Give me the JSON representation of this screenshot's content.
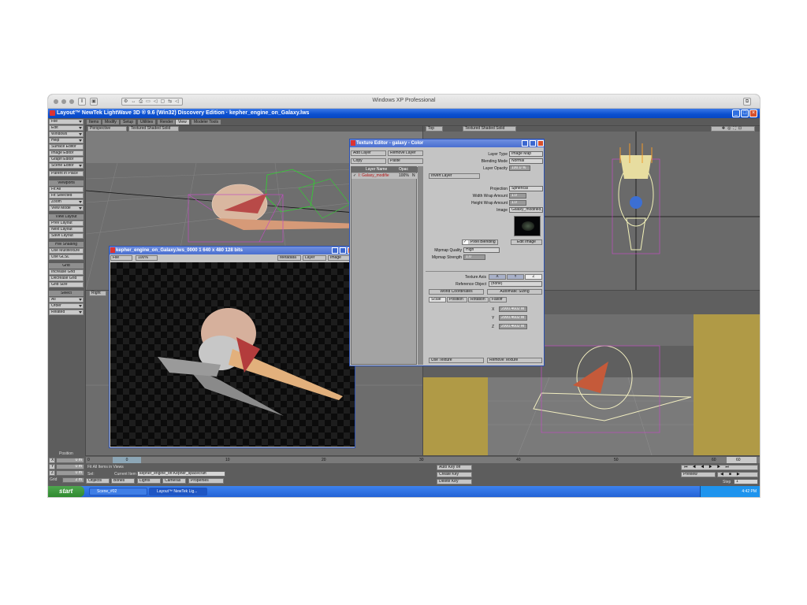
{
  "vm": {
    "title": "Windows XP Professional"
  },
  "app": {
    "title": "Layout™ NewTek LightWave 3D ® 9.6  (Win32) Discovery Edition · kepher_engine_on_Galaxy.lws"
  },
  "tabs": [
    "Items",
    "Modify",
    "Setup",
    "Utilities",
    "Render",
    "View",
    "Modeler Tools"
  ],
  "left_panel": {
    "menu": [
      "File",
      "Edit",
      "Windows",
      "Help",
      "Surface Editor",
      "Image Editor",
      "Graph Editor",
      "Scene Editor",
      "Parent in Place"
    ],
    "viewports_header": "Viewports",
    "viewports": [
      "Fit All",
      "Fit Selected",
      "Zoom",
      "View Mode"
    ],
    "view_layout_header": "View Layout",
    "view_layout": [
      "Prev Layout",
      "Next Layout",
      "Save Layout"
    ],
    "hw_header": "HW Shading",
    "hw": [
      "Use Multitexture",
      "Use GLSL"
    ],
    "grid_header": "Grid",
    "grid": [
      "Increase Grid",
      "Decrease Grid",
      "Grid Size"
    ],
    "select_header": "Select",
    "select": [
      "All",
      "Order",
      "Related"
    ]
  },
  "viewports": {
    "tl": {
      "view": "Perspective",
      "mode": "Textured Shaded Solid"
    },
    "tr": {
      "view": "Top",
      "mode": "Textured Shaded Solid"
    },
    "bl": {
      "view": "Right"
    }
  },
  "image_viewer": {
    "title": "kepher_engine_on_Galaxy.lws_0000 1  640 x 480 128 bits",
    "file": "File",
    "zoom": "100%",
    "metadata": "Metadata",
    "layer": "Layer",
    "image": "Image"
  },
  "texture_editor": {
    "title": "Texture Editor - galaxy - Color",
    "add_layer": "Add Layer",
    "remove_layer": "Remove Layer",
    "copy": "Copy",
    "paste": "Paste",
    "col_layer_name": "Layer Name",
    "col_opac": "Opac",
    "layer_row_name": "I: Galaxy_modifie",
    "layer_row_opac": "100%",
    "layer_row_blend": "N",
    "layer_type_label": "Layer Type",
    "layer_type": "Image Map",
    "blending_mode_label": "Blending Mode",
    "blending_mode": "Normal",
    "layer_opacity_label": "Layer Opacity",
    "layer_opacity": "100.0 %",
    "invert_layer": "Invert Layer",
    "projection_label": "Projection",
    "projection": "Spherical",
    "width_wrap_label": "Width Wrap Amount",
    "width_wrap": "1.0",
    "height_wrap_label": "Height Wrap Amount",
    "height_wrap": "1.0",
    "image_label": "Image",
    "image": "Galaxy_modified.jpg",
    "pixel_blending": "Pixel Blending",
    "edit_image": "Edit Image",
    "mipmap_quality_label": "Mipmap Quality",
    "mipmap_quality": "High",
    "mipmap_strength_label": "Mipmap Strength",
    "mipmap_strength": "1.0",
    "texture_axis_label": "Texture Axis",
    "axes": [
      "X",
      "Y",
      "Z"
    ],
    "reference_object_label": "Reference Object",
    "reference_object": "(none)",
    "world_coordinates": "World Coordinates",
    "automatic_sizing": "Automatic Sizing",
    "subtabs": [
      "Scale",
      "Position",
      "Rotation",
      "Falloff"
    ],
    "scale_x_label": "X",
    "scale_x": "2000.4602 M",
    "scale_y_label": "Y",
    "scale_y": "2000.4602 M",
    "scale_z_label": "Z",
    "scale_z": "2000.4602 M",
    "use_texture": "Use Texture",
    "remove_texture": "Remove Texture"
  },
  "bottom": {
    "position": "Position",
    "x": "X",
    "y": "Y",
    "z": "Z",
    "x_val": "0 m",
    "y_val": "0 m",
    "z_val": "0 m",
    "grid_label": "Grid",
    "grid_val": "2 m",
    "timeline_ticks": [
      "0",
      "10",
      "20",
      "30",
      "40",
      "50",
      "60"
    ],
    "current_frame": "0",
    "end_frame": "60",
    "status": "Fit All Items in Views",
    "sel_label": "Sel:",
    "current_item_label": "Current Item",
    "current_item": "kepher_engine_on:Kepher_spacecraft",
    "objects": "Objects",
    "bones": "Bones",
    "lights": "Lights",
    "cameras": "Cameras",
    "properties": "Properties",
    "auto_key": "Auto Key",
    "auto_key_val": "off",
    "create_key": "Create Key",
    "delete_key": "Delete Key",
    "preview": "Preview",
    "step_label": "Step",
    "step_val": "1"
  },
  "taskbar": {
    "start": "start",
    "tasks": [
      "Scene_#02",
      "Layout™ NewTek Lig..."
    ],
    "clock": "4:42 PM"
  }
}
